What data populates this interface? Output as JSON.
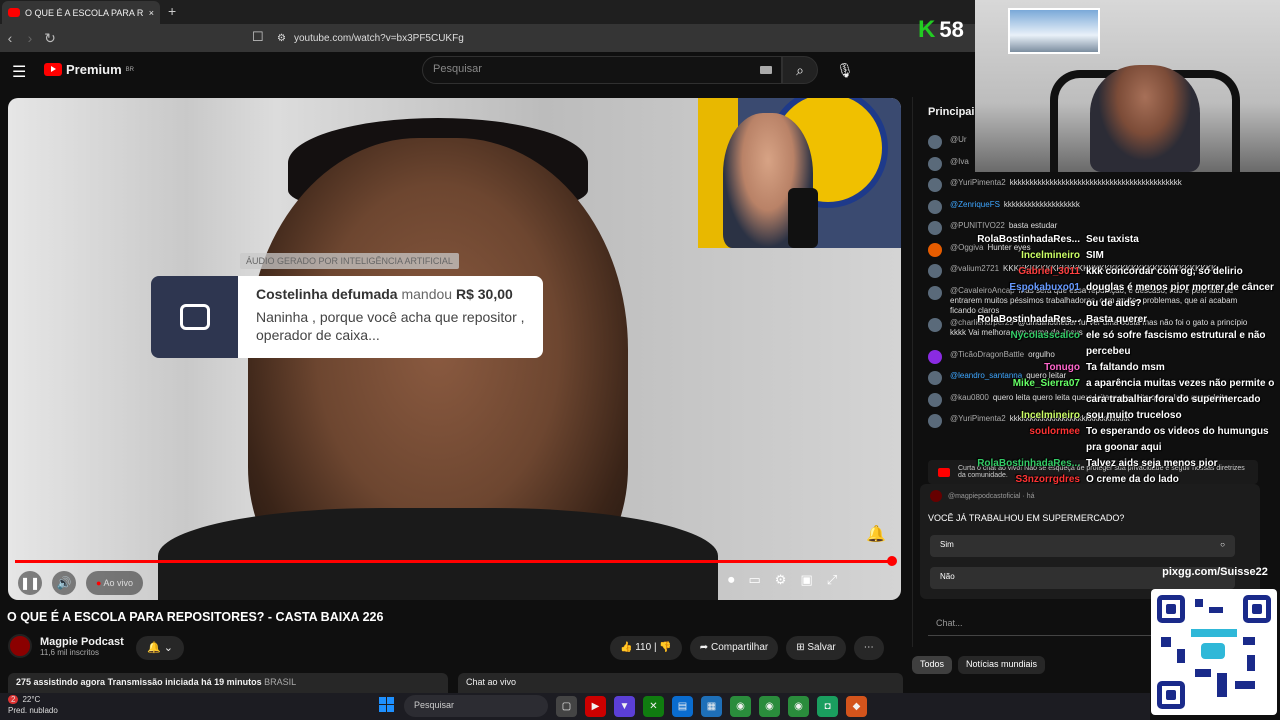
{
  "browser": {
    "tab_title": "O QUE É A ESCOLA PARA RE",
    "tab_close": "×",
    "new_tab": "+",
    "url": "youtube.com/watch?v=bx3PF5CUKFg"
  },
  "youtube": {
    "logo_text": "Premium",
    "logo_region": "BR",
    "search_placeholder": "Pesquisar"
  },
  "video": {
    "ai_tag": "ÁUDIO GERADO POR INTELIGÊNCIA ARTIFICIAL",
    "donation": {
      "name": "Costelinha defumada",
      "verb": "mandou",
      "amount": "R$ 30,00",
      "message": "Naninha , porque você acha que repositor , operador de caixa..."
    },
    "live_label": "Ao vivo",
    "title": "O QUE É A ESCOLA PARA REPOSITORES? - CASTA BAIXA 226",
    "channel_name": "Magpie Podcast",
    "subscribers": "11,6 mil inscritos",
    "likes": "110",
    "share_label": "Compartilhar",
    "save_label": "Salvar",
    "watching": "275 assistindo agora",
    "started": "Transmissão iniciada há 19 minutos",
    "country": "BRASIL",
    "chat_live_label": "Chat ao vivo"
  },
  "chat": {
    "header": "Principais",
    "messages": [
      {
        "author": "@Ur",
        "text": ""
      },
      {
        "author": "@Iva",
        "text": ""
      },
      {
        "author": "@YuriPimenta2",
        "text": "kkkkkkkkkkkkkkkkkkkkkkkkkkkkkkkkkkkkkkkkkkk"
      },
      {
        "author": "@ZenriqueFS",
        "text": "kkkkkkkkkkkkkkkkkkk"
      },
      {
        "author": "@PUNITIVO22",
        "text": "basta estudar"
      },
      {
        "author": "@Oggiva",
        "text": "Hunter eyes"
      },
      {
        "author": "@valium2721",
        "text": "KKKKKKKKKKKKKKKKKKKKKKKKKKKKKKKKKKKKKKKK"
      },
      {
        "author": "@CavaleiroAncap",
        "text": "Mas será que essa reputação, e descaso, não é pelo fato de entrarem muitos péssimos trabalhadores, com muitos problemas, que aí acabam ficando claros"
      },
      {
        "author": "@charlieharper29",
        "text": "@umulinotheber fui ver uma bosta mas não foi o gato a princípio kkkk Vai melhorar em nome de Jesus"
      },
      {
        "author": "@TicãoDragonBattle",
        "text": "orgulho"
      },
      {
        "author": "@leandro_santanna",
        "text": "quero leitar"
      },
      {
        "author": "@kau0800",
        "text": "quero leita quero leita quero leita quero leita quero leita quero leita"
      },
      {
        "author": "@YuriPimenta2",
        "text": "kkkkkkkkkkkkkkkkkkkkkkkkkkkkkk"
      }
    ],
    "pinned_notice": "Curta o chat ao vivo! Não se esqueça de proteger sua privacidade e seguir nossas diretrizes da comunidade.",
    "poll_author": "@magpiepodcastoficial · há",
    "poll_question": "VOCÊ JÁ TRABALHOU EM SUPERMERCADO?",
    "poll_options": [
      "Sim",
      "Não"
    ],
    "input_placeholder": "Chat...",
    "chips": [
      "Todos",
      "Notícias mundiais"
    ]
  },
  "stream_overlay": {
    "viewer_count": "58",
    "viewer_icon": "K",
    "bot_chat": [
      {
        "name": "RolaBostinhadaRes...",
        "text": "Seu taxista"
      },
      {
        "name": "Incelmineiro",
        "text": "SIM"
      },
      {
        "name": "Gabriel_3011",
        "text": "kkk concordar com og, só delirio"
      },
      {
        "name": "Espokabuxo01",
        "text": "douglas é menos pior morrer de câncer ou de aids?"
      },
      {
        "name": "RolaBostinhadaRes...",
        "text": "Basta querer"
      },
      {
        "name": "Nycolasscalco",
        "text": "ele só sofre fascismo estrutural e não percebeu"
      },
      {
        "name": "Tonugo",
        "text": "Ta faltando msm"
      },
      {
        "name": "Mike_Sierra07",
        "text": "a aparência muitas vezes não permite o cara trabalhar fora do supermercado"
      },
      {
        "name": "Incelmineiro",
        "text": "sou muito truceloso"
      },
      {
        "name": "soulormee",
        "text": "To esperando os videos do humungus pra goonar aqui"
      },
      {
        "name": "RolaBostinhadaRes...",
        "text": "Talvez aids seja menos pior"
      },
      {
        "name": "S3nzorrgdres",
        "text": "O creme da do lado"
      }
    ],
    "pix_url": "pixgg.com/Suisse22"
  },
  "taskbar": {
    "weather_badge": "2",
    "temperature": "22°C",
    "weather_desc": "Pred. nublado",
    "search_placeholder": "Pesquisar"
  }
}
